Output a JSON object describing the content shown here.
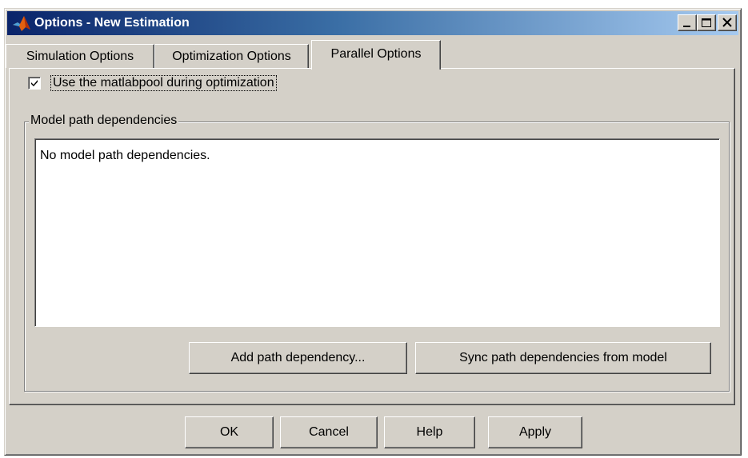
{
  "window": {
    "title": "Options - New Estimation",
    "app_icon": "matlab-logo-icon",
    "controls": [
      "minimize-icon",
      "maximize-icon",
      "close-icon"
    ]
  },
  "tabs": [
    {
      "label": "Simulation Options",
      "selected": false
    },
    {
      "label": "Optimization Options",
      "selected": false
    },
    {
      "label": "Parallel Options",
      "selected": true
    }
  ],
  "parallel": {
    "use_matlabpool_label": "Use the matlabpool during optimization",
    "use_matlabpool_checked": true,
    "group_label": "Model path dependencies",
    "list_text": "No model path dependencies.",
    "add_button": "Add path dependency...",
    "sync_button": "Sync path dependencies from model"
  },
  "footer": {
    "ok": "OK",
    "cancel": "Cancel",
    "help": "Help",
    "apply": "Apply"
  },
  "colors": {
    "face": "#d4d0c8",
    "title_start": "#0a246a",
    "title_end": "#a6caf0"
  }
}
